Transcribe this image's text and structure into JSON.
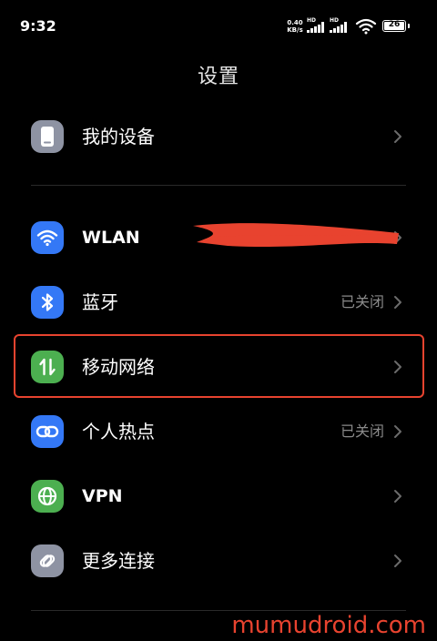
{
  "status_bar": {
    "time": "9:32",
    "net_speed_value": "0.40",
    "net_speed_unit": "KB/s",
    "sim1_badge": "HD",
    "sim2_badge": "HD",
    "battery_level": "26"
  },
  "header": {
    "title": "设置"
  },
  "items": [
    {
      "label": "我的设备",
      "value": "",
      "icon": "phone-device-icon",
      "icon_color": "#8e93a3"
    },
    {
      "label": "WLAN",
      "value": "",
      "icon": "wifi-icon",
      "icon_color": "#3478f6"
    },
    {
      "label": "蓝牙",
      "value": "已关闭",
      "icon": "bluetooth-icon",
      "icon_color": "#3478f6"
    },
    {
      "label": "移动网络",
      "value": "",
      "icon": "mobile-data-icon",
      "icon_color": "#4caf50"
    },
    {
      "label": "个人热点",
      "value": "已关闭",
      "icon": "hotspot-link-icon",
      "icon_color": "#3478f6"
    },
    {
      "label": "VPN",
      "value": "",
      "icon": "globe-icon",
      "icon_color": "#4caf50"
    },
    {
      "label": "更多连接",
      "value": "",
      "icon": "more-connections-icon",
      "icon_color": "#8e93a3"
    }
  ],
  "annotations": {
    "highlight_color": "#e8432f"
  },
  "watermark": "mumudroid.com"
}
